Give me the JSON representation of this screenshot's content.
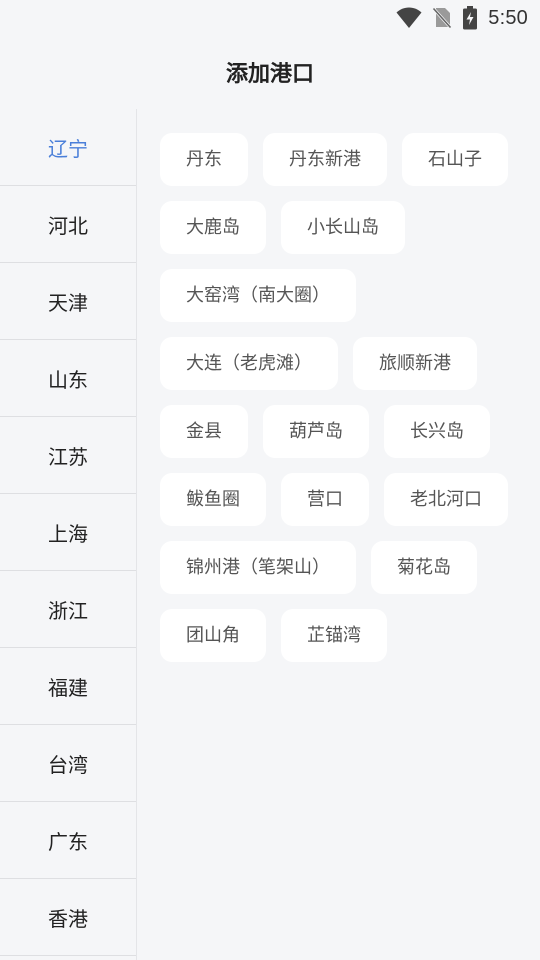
{
  "status_bar": {
    "time": "5:50",
    "icons": [
      "wifi-icon",
      "no-sim-icon",
      "battery-charging-icon"
    ]
  },
  "header": {
    "title": "添加港口"
  },
  "sidebar": {
    "items": [
      {
        "label": "辽宁",
        "active": true
      },
      {
        "label": "河北"
      },
      {
        "label": "天津"
      },
      {
        "label": "山东"
      },
      {
        "label": "江苏"
      },
      {
        "label": "上海"
      },
      {
        "label": "浙江"
      },
      {
        "label": "福建"
      },
      {
        "label": "台湾"
      },
      {
        "label": "广东"
      },
      {
        "label": "香港"
      }
    ]
  },
  "ports": {
    "rows": [
      [
        "丹东",
        "丹东新港",
        "石山子"
      ],
      [
        "大鹿岛",
        "小长山岛"
      ],
      [
        "大窑湾（南大圈）"
      ],
      [
        "大连（老虎滩）",
        "旅顺新港"
      ],
      [
        "金县",
        "葫芦岛",
        "长兴岛"
      ],
      [
        "鲅鱼圈",
        "营口",
        "老北河口"
      ],
      [
        "锦州港（笔架山）",
        "菊花岛"
      ],
      [
        "团山角",
        "芷锚湾"
      ]
    ]
  },
  "colors": {
    "background": "#f5f6f8",
    "chip_background": "#ffffff",
    "active": "#4a7fd9",
    "text": "#222222",
    "chip_text": "#555555"
  }
}
